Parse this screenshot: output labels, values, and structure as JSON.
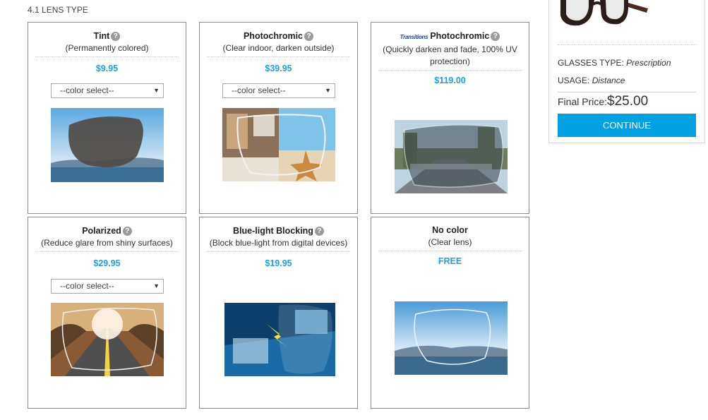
{
  "section_title": "4.1 LENS TYPE",
  "cards": [
    {
      "name": "Tint",
      "desc": "(Permanently colored)",
      "price": "$9.95",
      "select": "--color select--"
    },
    {
      "name": "Photochromic",
      "desc": "(Clear indoor, darken outside)",
      "price": "$39.95",
      "select": "--color select--"
    },
    {
      "brand": "Transitions",
      "name": "Photochromic",
      "desc": "(Quickly darken and fade, 100% UV protection)",
      "price": "$119.00"
    },
    {
      "name": "Polarized",
      "desc": "(Reduce glare from shiny surfaces)",
      "price": "$29.95",
      "select": "--color select--"
    },
    {
      "name": "Blue-light Blocking",
      "desc": "(Block blue-light from digital devices)",
      "price": "$19.95"
    },
    {
      "name": "No color",
      "desc": "(Clear lens)",
      "price": "FREE"
    }
  ],
  "summary": {
    "glasses_type_label": "GLASSES TYPE:",
    "glasses_type_value": "Prescription",
    "usage_label": "USAGE:",
    "usage_value": "Distance",
    "final_price_label": "Final Price:",
    "final_price_value": "$25.00",
    "continue_label": "CONTINUE"
  },
  "colors": {
    "accent": "#00a0e3",
    "price": "#1e9fe0",
    "border": "#8a8a8a"
  },
  "icons": {
    "help": "question-circle-icon",
    "dropdown": "caret-down-icon"
  }
}
